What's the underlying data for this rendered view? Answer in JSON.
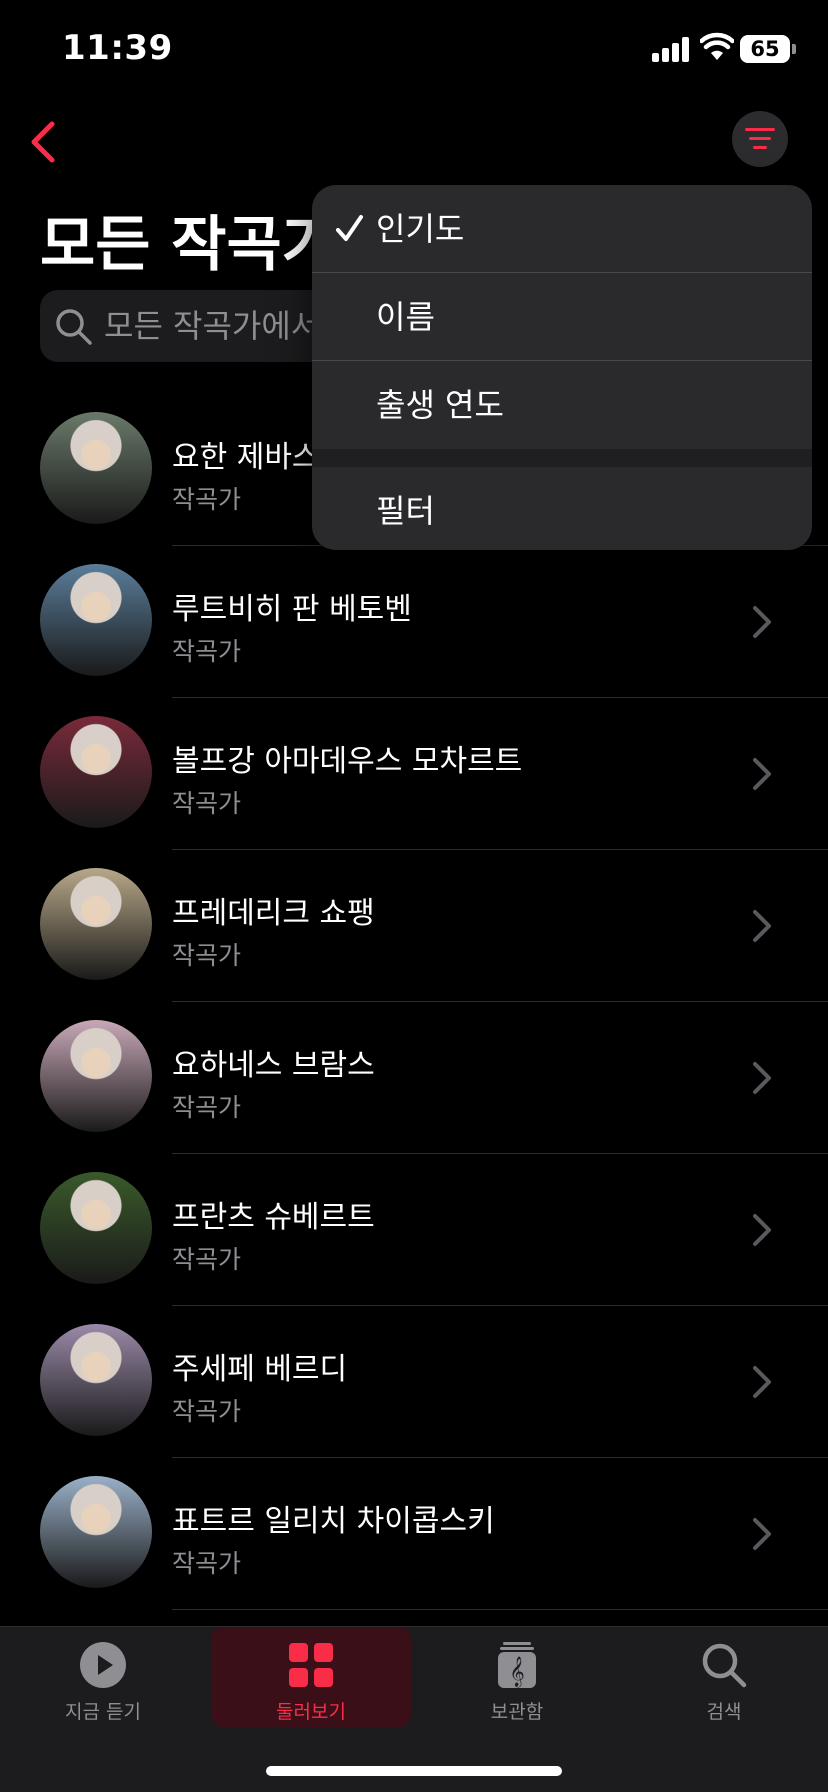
{
  "status_bar": {
    "time": "11:39",
    "battery": "65"
  },
  "page": {
    "title": "모든 작곡가"
  },
  "search": {
    "placeholder": "모든 작곡가에서 검색"
  },
  "composers": [
    {
      "name": "요한 제바스티안 바흐",
      "subtitle": "작곡가",
      "avatar_color": "#6a7a6a"
    },
    {
      "name": "루트비히 판 베토벤",
      "subtitle": "작곡가",
      "avatar_color": "#5a7d9a"
    },
    {
      "name": "볼프강 아마데우스 모차르트",
      "subtitle": "작곡가",
      "avatar_color": "#7a2a3a"
    },
    {
      "name": "프레데리크 쇼팽",
      "subtitle": "작곡가",
      "avatar_color": "#b8a88a"
    },
    {
      "name": "요하네스 브람스",
      "subtitle": "작곡가",
      "avatar_color": "#c8a8b8"
    },
    {
      "name": "프란츠 슈베르트",
      "subtitle": "작곡가",
      "avatar_color": "#3a5a2a"
    },
    {
      "name": "주세페 베르디",
      "subtitle": "작곡가",
      "avatar_color": "#9a8aa8"
    },
    {
      "name": "표트르 일리치 차이콥스키",
      "subtitle": "작곡가",
      "avatar_color": "#9ab0c8"
    }
  ],
  "sort_menu": {
    "items": [
      {
        "label": "인기도",
        "selected": true
      },
      {
        "label": "이름",
        "selected": false
      },
      {
        "label": "출생 연도",
        "selected": false
      },
      {
        "label": "필터",
        "selected": false
      }
    ]
  },
  "tabs": [
    {
      "label": "지금 듣기",
      "icon": "play-circle-icon",
      "active": false
    },
    {
      "label": "둘러보기",
      "icon": "grid-icon",
      "active": true
    },
    {
      "label": "보관함",
      "icon": "library-icon",
      "active": false
    },
    {
      "label": "검색",
      "icon": "search-icon",
      "active": false
    }
  ],
  "colors": {
    "accent": "#fa2d48",
    "background": "#000000",
    "secondary_text": "#8e8e93"
  }
}
